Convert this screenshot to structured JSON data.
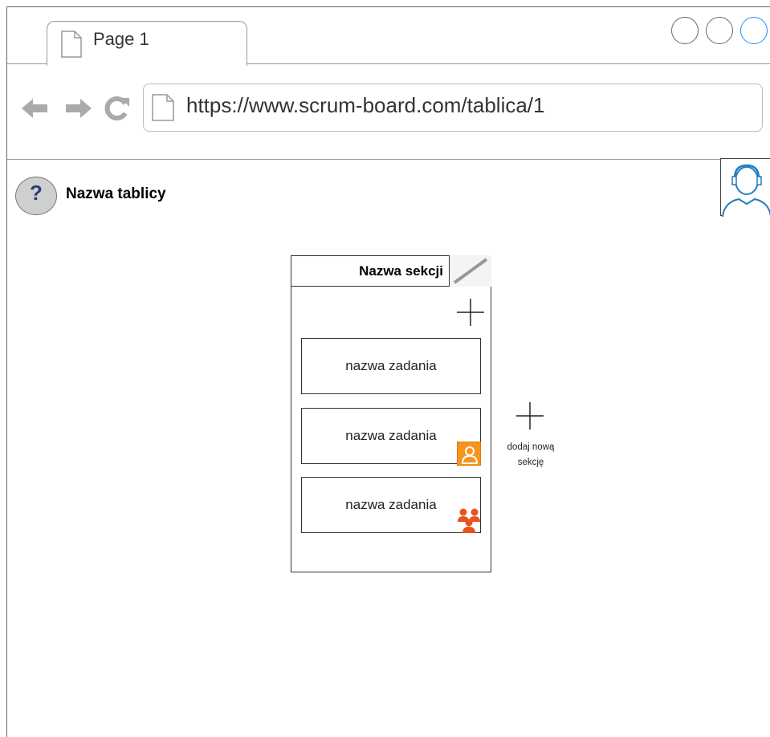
{
  "browser": {
    "tab_title": "Page 1",
    "url": "https://www.scrum-board.com/tablica/1",
    "window_controls": [
      "circle-icon",
      "circle-icon",
      "circle-icon"
    ],
    "accent_color": "#1e90ff"
  },
  "page": {
    "help_icon_text": "?",
    "board_title": "Nazwa tablicy",
    "avatar_icon": "user-avatar-icon"
  },
  "section": {
    "title": "Nazwa sekcji",
    "edit_icon": "pencil-icon",
    "add_task_icon": "plus-icon",
    "tasks": [
      {
        "label": "nazwa zadania",
        "badge": ""
      },
      {
        "label": "nazwa zadania",
        "badge": "person-icon"
      },
      {
        "label": "nazwa zadania",
        "badge": "group-icon"
      }
    ]
  },
  "add_section": {
    "label_line1": "dodaj nową",
    "label_line2": "sekcję",
    "icon": "plus-icon"
  },
  "colors": {
    "person_badge": "#f7941d",
    "group_badge": "#e8541e",
    "help_icon": "#2b3f78"
  }
}
